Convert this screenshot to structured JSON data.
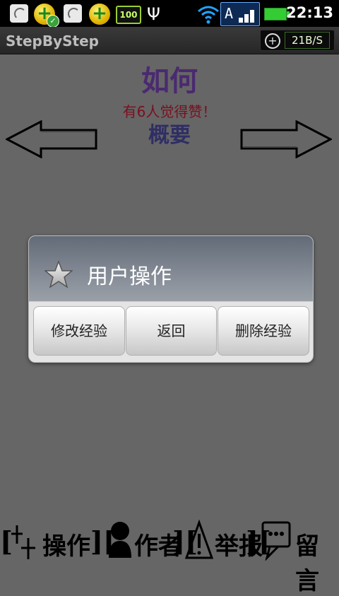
{
  "status_bar": {
    "icons": [
      "signal-off-icon",
      "plus-check-icon",
      "signal-off-icon",
      "plus-icon",
      "battery-100-icon",
      "usb-icon",
      "wifi-icon",
      "network-a-icon",
      "battery-icon"
    ],
    "battery_text": "100",
    "network_letter": "A",
    "time": "22:13"
  },
  "titlebar": {
    "title": "StepByStep",
    "speed": "21B/S"
  },
  "content": {
    "howto": "如何",
    "likes": "有6人觉得赞！",
    "summary": "概要"
  },
  "dialog": {
    "title": "用户操作",
    "buttons": [
      "修改经验",
      "返回",
      "删除经验"
    ]
  },
  "bottom_bar": {
    "operate": "操作",
    "author": "作者",
    "report": "举报",
    "comment": "留言"
  },
  "colors": {
    "background": "#666666",
    "howto": "#4a2a70",
    "likes": "#7a0f1f",
    "summary": "#2f2e64"
  }
}
